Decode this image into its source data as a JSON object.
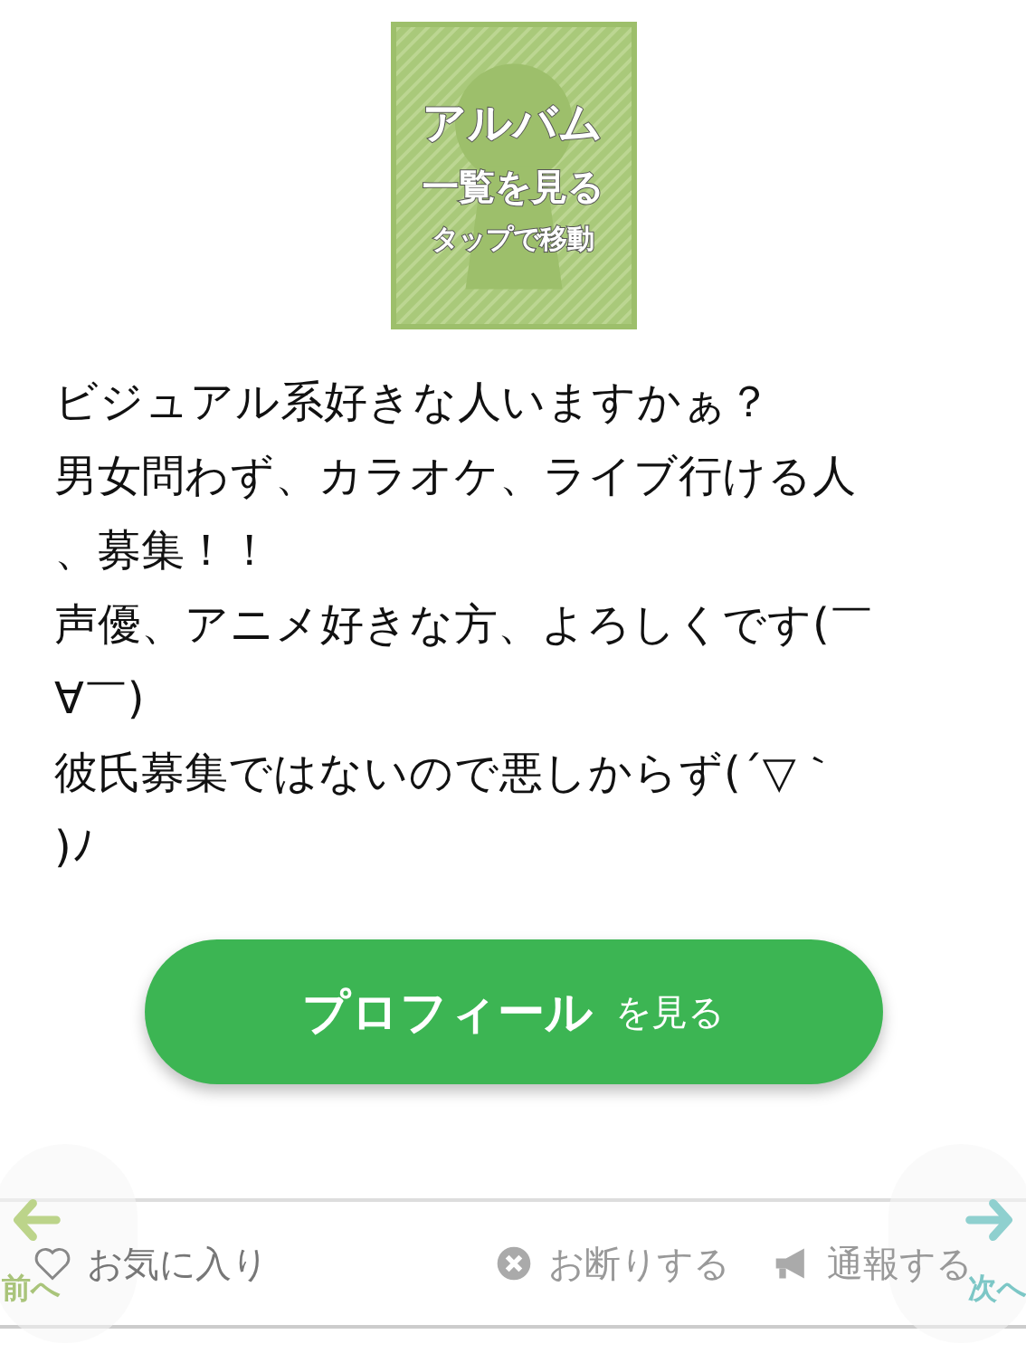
{
  "album": {
    "title": "アルバム",
    "subtitle": "一覧を見る",
    "hint": "タップで移動"
  },
  "message_lines": [
    "ビジュアル系好きな人いますかぁ？",
    "男女問わず、カラオケ、ライブ行ける人",
    "、募集！！",
    "声優、アニメ好きな方、よろしくです(￣",
    "∀￣)",
    "彼氏募集ではないので悪しからず(´▽｀",
    ")ﾉ"
  ],
  "profile_button": {
    "main": "プロフィール",
    "sub": "を見る"
  },
  "actions": [
    {
      "kind": "favorite",
      "label": "お気に入り"
    },
    {
      "kind": "decline",
      "label": "お断りする"
    },
    {
      "kind": "report",
      "label": "通報する"
    }
  ],
  "nav": {
    "prev": "前へ",
    "next": "次へ"
  }
}
